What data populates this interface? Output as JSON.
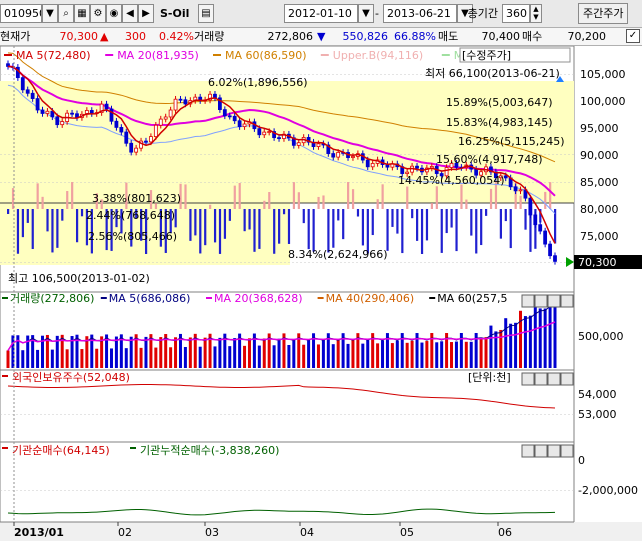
{
  "toolbar": {
    "code": "010950",
    "name": "S-Oil",
    "start_date": "2012-01-10",
    "end_date": "2013-06-21",
    "period_label": "총기간",
    "period_value": "360",
    "right_button": "주간주가"
  },
  "pricebar": {
    "label": "현재가",
    "price": "70,300",
    "change_arrow": "▲",
    "change": "300",
    "change_pct": "0.42%",
    "volume_label": "거래량",
    "volume": "272,806",
    "down_arrow": "▼",
    "ask_volume": "550,826",
    "ask_pct": "66.88%",
    "ask_label": "매도",
    "bid_price": "70,400",
    "bid_label": "매수",
    "last": "70,200"
  },
  "colors": {
    "up": "#e00000",
    "down": "#0000d0",
    "ma5": "#d00000",
    "ma20": "#e000e0",
    "ma60": "#d08000",
    "upper": "#f0b0b0",
    "mid": "#a0e0a0",
    "panel_bg_highlight": "#ffffc0"
  },
  "price_panel": {
    "legend": [
      {
        "key": "ma5",
        "text": "MA 5(72,480)",
        "color": "#d00000"
      },
      {
        "key": "ma20",
        "text": "MA 20(81,935)",
        "color": "#e000e0"
      },
      {
        "key": "ma60",
        "text": "MA 60(86,590)",
        "color": "#d08000"
      },
      {
        "key": "upper",
        "text": "Upper.B(94,116)",
        "color": "#f0b0b0"
      },
      {
        "key": "mid",
        "text": "Midd",
        "color": "#a0e0a0"
      }
    ],
    "tag": "[수정주가]",
    "low_note": "최저 66,100(2013-06-21)",
    "high_note": "최고 106,500(2013-01-02)",
    "current_tag": "70,300",
    "y_ticks": [
      "105,000",
      "100,000",
      "95,000",
      "90,000",
      "85,000",
      "80,000",
      "75,000",
      "70,000"
    ],
    "y_values": [
      105000,
      100000,
      95000,
      90000,
      85000,
      80000,
      75000,
      70000
    ],
    "annotations": [
      "6.02%(1,896,556)",
      "15.89%(5,003,647)",
      "15.83%(4,983,145)",
      "16.25%(5,115,245)",
      "15.60%(4,917,748)",
      "14.45%(4,560,054)",
      "3.38%(801,623)",
      "2.44%(768,648)",
      "2.56%(805,466)",
      "8.34%(2,624,966)"
    ]
  },
  "volume_panel": {
    "legend": [
      {
        "text": "거래량(272,806)",
        "color": "#006000"
      },
      {
        "text": "MA 5(686,086)",
        "color": "#000080"
      },
      {
        "text": "MA 20(368,628)",
        "color": "#e000e0"
      },
      {
        "text": "MA 40(290,406)",
        "color": "#d06000"
      },
      {
        "text": "MA 60(257,5",
        "color": "#000000"
      }
    ],
    "y_tick": "500,000"
  },
  "foreign_panel": {
    "legend": "외국인보유주수(52,048)",
    "unit": "[단위:천]",
    "y_ticks": [
      "54,000",
      "53,000"
    ]
  },
  "inst_panel": {
    "legend1": "기관순매수(64,145)",
    "legend2": "기관누적순매수(-3,838,260)",
    "y_ticks": [
      "0",
      "-2,000,000"
    ]
  },
  "x_axis": [
    "2013/01",
    "02",
    "03",
    "04",
    "05",
    "06"
  ]
}
